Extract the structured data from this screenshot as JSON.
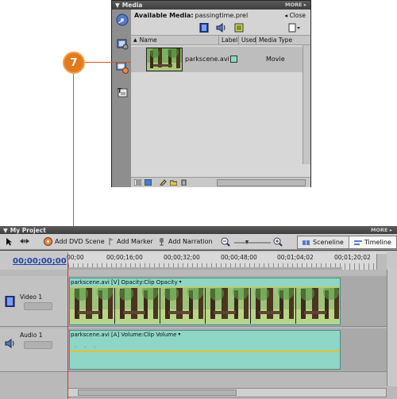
{
  "media": {
    "panel_title": "Media",
    "more_label": "MORE",
    "available_prefix": "Available Media:",
    "project_file": "passingtime.prel",
    "close_label": "Close",
    "columns": [
      "Name",
      "Label",
      "Used",
      "Media Type"
    ],
    "items": [
      {
        "name": "parkscene.avi",
        "type": "Movie",
        "label_color": "#8fd9c3"
      }
    ]
  },
  "callout": {
    "number": "7",
    "color": "#e27a1c"
  },
  "project": {
    "panel_title": "My Project",
    "more_label": "MORE",
    "toolbar": {
      "add_dvd_scene": "Add DVD Scene",
      "add_marker": "Add Marker",
      "add_narration": "Add Narration",
      "sceneline": "Sceneline",
      "timeline": "Timeline"
    },
    "timecode": "00;00;00;00",
    "ruler_labels": [
      "00;00",
      "00;00;16;00",
      "00;00;32;00",
      "00;00;48;00",
      "00;01;04;02",
      "00;01;20;02"
    ],
    "tracks": {
      "video": {
        "name": "Video 1",
        "clip_label": "parkscene.avi [V] Opacity:Clip Opacity"
      },
      "audio": {
        "name": "Audio 1",
        "clip_label": "parkscene.avi [A] Volume:Clip Volume"
      }
    }
  }
}
